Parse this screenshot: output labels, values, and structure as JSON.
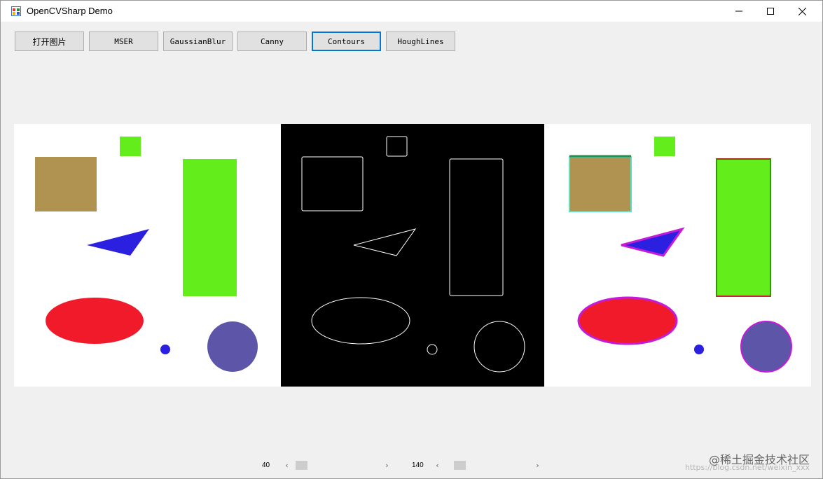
{
  "window": {
    "title": "OpenCVSharp Demo",
    "app_icon": "winforms-app-icon",
    "controls": {
      "minimize": "minimize-icon",
      "maximize": "maximize-icon",
      "close": "close-icon"
    }
  },
  "toolbar": {
    "buttons": [
      {
        "label": "打开图片"
      },
      {
        "label": "MSER"
      },
      {
        "label": "GaussianBlur"
      },
      {
        "label": "Canny"
      },
      {
        "label": "Contours"
      },
      {
        "label": "HoughLines"
      }
    ],
    "active": "Contours"
  },
  "scrollbars": {
    "threshold1": {
      "value": "40"
    },
    "threshold2": {
      "value": "140"
    }
  },
  "colors": {
    "accent": "#0078d7",
    "tan": "#b09251",
    "green": "#63ee1b",
    "blue": "#2b1fe0",
    "red": "#f11a2a",
    "slate": "#5d56a8",
    "contour_magenta": "#c51bd8"
  },
  "watermark": {
    "text": "@稀土掘金技术社区",
    "url": "https://blog.csdn.net/weixin_xxx"
  }
}
